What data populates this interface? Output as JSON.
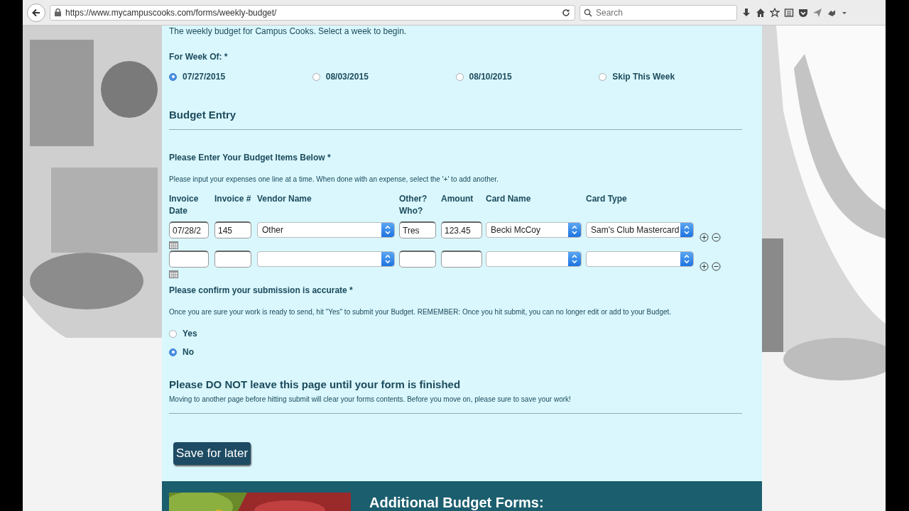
{
  "browser": {
    "url": "https://www.mycampuscooks.com/forms/weekly-budget/",
    "search": {
      "placeholder": "Search"
    }
  },
  "intro": "The weekly budget for Campus Cooks. Select a week to begin.",
  "week": {
    "label": "For Week Of:",
    "required": "*",
    "options": [
      {
        "label": "07/27/2015",
        "selected": true
      },
      {
        "label": "08/03/2015",
        "selected": false
      },
      {
        "label": "08/10/2015",
        "selected": false
      },
      {
        "label": "Skip This Week",
        "selected": false
      }
    ]
  },
  "section_title": "Budget Entry",
  "items": {
    "label": "Please Enter Your Budget Items Below",
    "required": "*",
    "help": "Please input your expenses one line at a time. When done with an expense, select the '+' to add another.",
    "columns": [
      "Invoice Date",
      "Invoice #",
      "Vendor Name",
      "Other? Who?",
      "Amount",
      "Card Name",
      "Card Type"
    ],
    "rows": [
      {
        "invoice_date": "07/28/2",
        "invoice_no": "145",
        "vendor": "Other",
        "other_who": "Tres",
        "amount": "123.45",
        "card_name": "Becki McCoy",
        "card_type": "Sam's Club Mastercard"
      },
      {
        "invoice_date": "",
        "invoice_no": "",
        "vendor": "",
        "other_who": "",
        "amount": "",
        "card_name": "",
        "card_type": ""
      }
    ]
  },
  "confirm": {
    "label": "Please confirm your submission is accurate",
    "required": "*",
    "help": "Once you are sure your work is ready to send, hit \"Yes\" to submit your Budget. REMEMBER: Once you hit submit, you can no longer edit or add to your Budget.",
    "options": [
      {
        "label": "Yes",
        "selected": false
      },
      {
        "label": "No",
        "selected": true
      }
    ]
  },
  "warning": {
    "title": "Please DO NOT leave this page until your form is finished",
    "text": "Moving to another page before hitting submit will clear your forms contents. Before you move on, please sure to save your work!"
  },
  "save_button": "Save for later",
  "footer": {
    "title": "Additional Budget Forms:"
  }
}
